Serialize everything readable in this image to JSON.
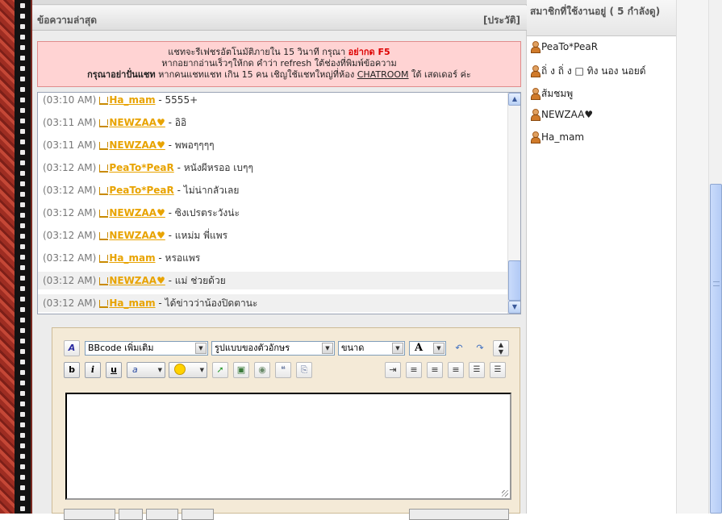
{
  "latest": {
    "title": "ข้อความล่าสุด",
    "history": "[ประวัติ]"
  },
  "notice": {
    "line1_pre": "แชทจะรีเฟชรอัตโนมัติภายใน 15 วินาที กรุณา ",
    "line1_red": "อย่ากด F5",
    "line2": "หากอยากอ่านเร็วๆให้กด คำว่า refresh ใต้ช่องที่พิมพ์ข้อความ",
    "line3_bold": "กรุณาอย่าปั่นแชท",
    "line3_mid": " หากคนแชทแชท เกิน 15 คน เชิญใช้แชทใหญ่ที่ห้อง ",
    "line3_link": "CHATROOM",
    "line3_end": " ใต้ เสดเดอร์ ค่ะ"
  },
  "messages": [
    {
      "time": "(03:10 AM)",
      "user": "Ha_mam",
      "text": " - 5555+"
    },
    {
      "time": "(03:11 AM)",
      "user": "NEWZAA♥",
      "text": " - อิอิ"
    },
    {
      "time": "(03:11 AM)",
      "user": "NEWZAA♥",
      "text": " - พพอๆๆๆๆ"
    },
    {
      "time": "(03:12 AM)",
      "user": "PeaTo*PeaR",
      "text": " - หนังผีหรออ เบๆๆ"
    },
    {
      "time": "(03:12 AM)",
      "user": "PeaTo*PeaR",
      "text": " - ไม่น่ากลัวเลย"
    },
    {
      "time": "(03:12 AM)",
      "user": "NEWZAA♥",
      "text": " - ซิงเปรตระวังน่ะ"
    },
    {
      "time": "(03:12 AM)",
      "user": "NEWZAA♥",
      "text": " - แหม่ม พี่แพร"
    },
    {
      "time": "(03:12 AM)",
      "user": "Ha_mam",
      "text": " - หรอแพร"
    },
    {
      "time": "(03:12 AM)",
      "user": "NEWZAA♥",
      "text": " - แม่ ช่วยด้วย"
    },
    {
      "time": "(03:12 AM)",
      "user": "Ha_mam",
      "text": " - ได้ข่าวว่าน้องปิดตานะ"
    }
  ],
  "editor": {
    "bbcode_select": "BBcode เพิ่มเติม",
    "font_select": "รูปแบบของตัวอักษร",
    "size_select": "ขนาด",
    "color_label": "A",
    "bold_label": "b",
    "italic_label": "i",
    "underline_label": "u",
    "textarea_value": ""
  },
  "members": {
    "title": "สมาชิกที่ใช้งานอยู่ ( 5 กำลังดู)",
    "list": [
      "PeaTo*PeaR",
      "ถิ่ ง ถิ่ ง □ ทิง นอง นอยด์",
      "ส้มชมพู",
      "NEWZAA♥",
      "Ha_mam"
    ]
  },
  "colors": {
    "username": "#e8a300",
    "notice_bg": "#ffd3d3",
    "notice_red": "#dd0000",
    "editor_bg": "#f4ead7"
  }
}
